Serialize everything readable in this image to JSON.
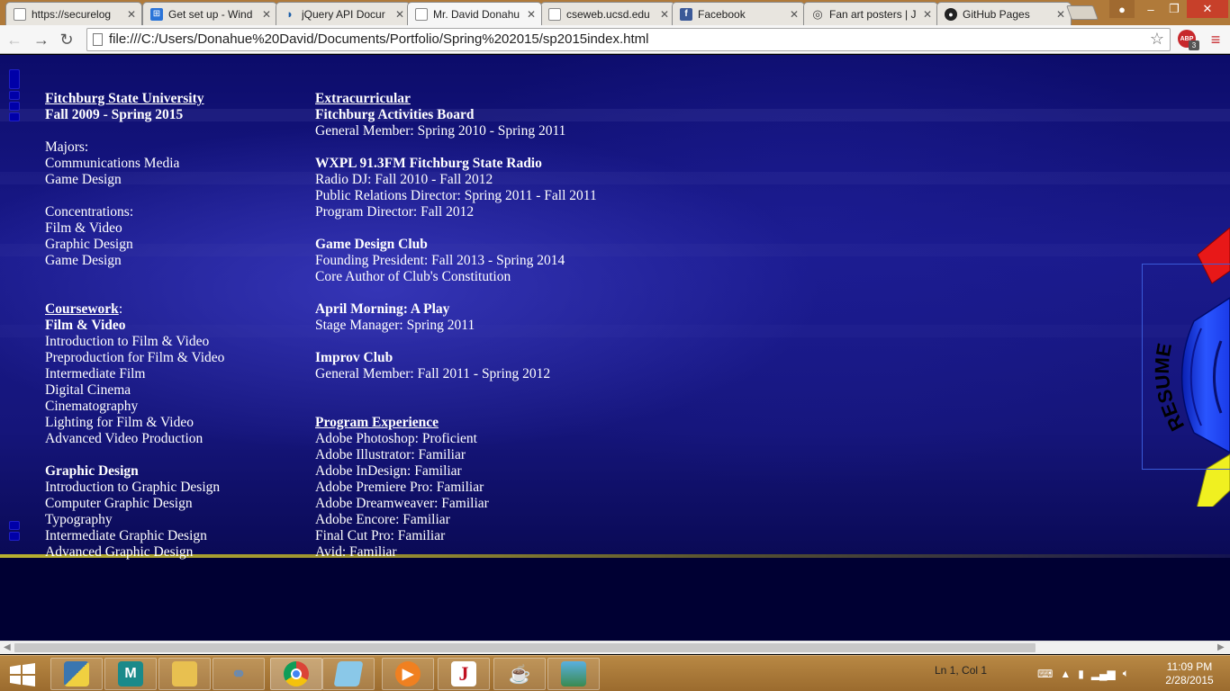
{
  "browser": {
    "tabs": [
      {
        "title": "https://securelog",
        "favicon": "document-icon"
      },
      {
        "title": "Get set up - Wind",
        "favicon": "windows-icon"
      },
      {
        "title": "jQuery API Docur",
        "favicon": "jquery-icon"
      },
      {
        "title": "Mr. David Donahu",
        "favicon": "document-icon",
        "active": true
      },
      {
        "title": "cseweb.ucsd.edu",
        "favicon": "document-icon"
      },
      {
        "title": "Facebook",
        "favicon": "facebook-icon"
      },
      {
        "title": "Fan art posters | J",
        "favicon": "globe-icon"
      },
      {
        "title": "GitHub Pages",
        "favicon": "github-icon"
      }
    ],
    "address": "file:///C:/Users/Donahue%20David/Documents/Portfolio/Spring%202015/sp2015index.html",
    "extension_badge": "ABP",
    "extension_count": "3"
  },
  "resume": {
    "col1": {
      "school": "Fitchburg State University",
      "dates": "Fall 2009 - Spring 2015",
      "majors_label": "Majors:",
      "majors": [
        "Communications Media",
        "Game Design"
      ],
      "concentrations_label": "Concentrations:",
      "concentrations": [
        "Film & Video",
        "Graphic Design",
        "Game Design"
      ],
      "coursework_label": "Coursework",
      "coursework_colon": ":",
      "film_heading": "Film & Video",
      "film_courses": [
        "Introduction to Film & Video",
        "Preproduction for Film & Video",
        "Intermediate Film",
        "Digital Cinema",
        "Cinematography",
        "Lighting for Film & Video",
        "Advanced Video Production"
      ],
      "graphic_heading": "Graphic Design",
      "graphic_courses": [
        "Introduction to Graphic Design",
        "Computer Graphic Design",
        "Typography",
        "Intermediate Graphic Design",
        "Advanced Graphic Design"
      ]
    },
    "col2": {
      "extracurricular_label": "Extracurricular",
      "activities": [
        {
          "name": "Fitchburg Activities Board",
          "roles": [
            "General Member: Spring 2010 - Spring 2011"
          ]
        },
        {
          "name": "WXPL 91.3FM Fitchburg State Radio",
          "roles": [
            "Radio DJ: Fall 2010 - Fall 2012",
            "Public Relations Director: Spring 2011 - Fall 2011",
            "Program Director: Fall 2012"
          ]
        },
        {
          "name": "Game Design Club",
          "roles": [
            "Founding President: Fall 2013 - Spring 2014",
            "Core Author of Club's Constitution"
          ]
        },
        {
          "name": "April Morning: A Play",
          "roles": [
            "Stage Manager: Spring 2011"
          ]
        },
        {
          "name": "Improv Club",
          "roles": [
            "General Member: Fall 2011 - Spring 2012"
          ]
        }
      ],
      "program_label": "Program Experience",
      "programs": [
        "Adobe Photoshop: Proficient",
        "Adobe Illustrator: Familiar",
        "Adobe InDesign: Familiar",
        "Adobe Premiere Pro: Familiar",
        "Adobe Dreamweaver: Familiar",
        "Adobe Encore: Familiar",
        "Final Cut Pro: Familiar",
        "Avid: Familiar"
      ]
    },
    "wheel_label": "RESUME"
  },
  "taskbar": {
    "status": "Ln 1, Col 1",
    "time": "11:09 PM",
    "date": "2/28/2015"
  },
  "colors": {
    "page_bg": "#15157a",
    "gold_line": "#b8b030",
    "wheel_blue": "#1a3ae8",
    "wheel_red": "#e81818",
    "wheel_yellow": "#f0f020",
    "taskbar": "#a97a3a"
  }
}
